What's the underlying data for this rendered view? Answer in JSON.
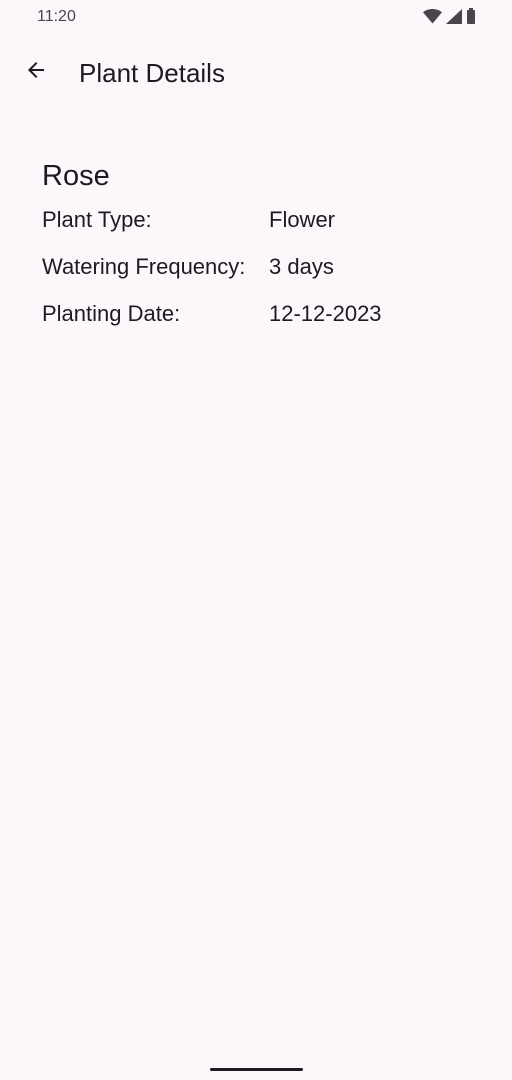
{
  "status_bar": {
    "time": "11:20",
    "icons": [
      "wifi-icon",
      "signal-icon",
      "battery-icon"
    ]
  },
  "app_bar": {
    "back_icon": "arrow-back-icon",
    "title": "Plant Details"
  },
  "plant": {
    "name": "Rose",
    "details": [
      {
        "label": "Plant Type:",
        "value": "Flower"
      },
      {
        "label": "Watering Frequency:",
        "value": "3 days"
      },
      {
        "label": "Planting Date:",
        "value": "12-12-2023"
      }
    ]
  },
  "colors": {
    "background": "#fdf7fb",
    "text": "#1d1b20",
    "status_text": "#49454f"
  }
}
